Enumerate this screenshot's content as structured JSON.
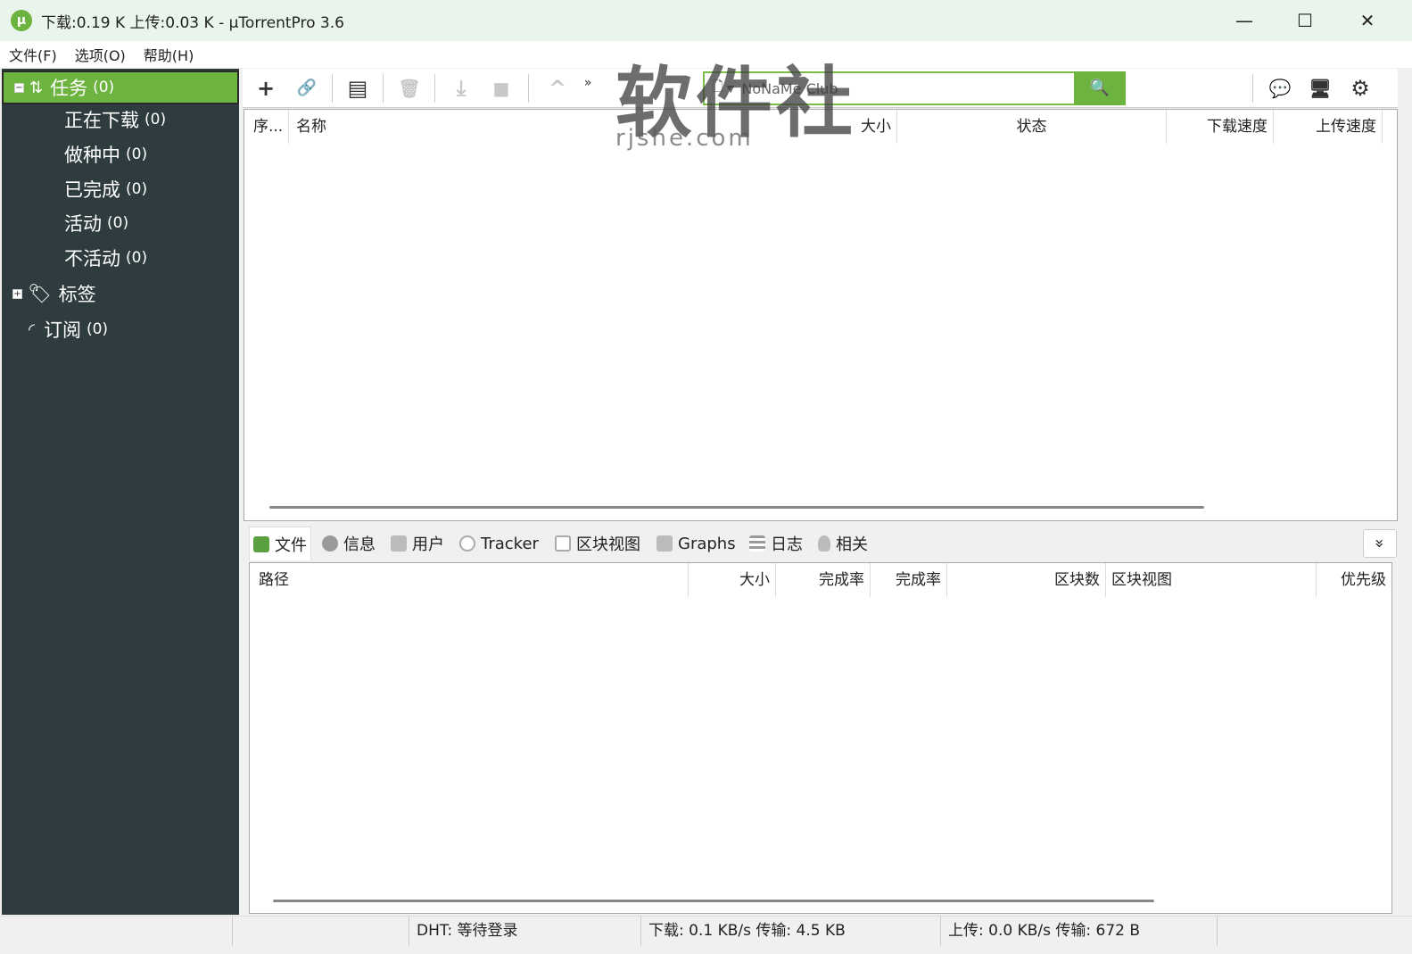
{
  "window": {
    "title": "下载:0.19 K 上传:0.03 K - µTorrentPro 3.6",
    "logo": "µ",
    "minimize": "—",
    "maximize": "☐",
    "close": "✕"
  },
  "menu": [
    "文件(F)",
    "选项(O)",
    "帮助(H)"
  ],
  "sidebar": {
    "tasks": {
      "label": "任务",
      "count": "(0)"
    },
    "items": [
      {
        "label": "正在下载",
        "count": "(0)"
      },
      {
        "label": "做种中",
        "count": "(0)"
      },
      {
        "label": "已完成",
        "count": "(0)"
      },
      {
        "label": "活动",
        "count": "(0)"
      },
      {
        "label": "不活动",
        "count": "(0)"
      }
    ],
    "labels": {
      "label": "标签"
    },
    "feeds": {
      "label": "订阅",
      "count": "(0)"
    }
  },
  "toolbar": {
    "add": "+",
    "add_url": "🔗",
    "create": "▤",
    "remove": "🗑",
    "download": "⤓",
    "stop": "■",
    "up": "^",
    "more": "»",
    "search_provider": "NoNaMe Club",
    "search_icon": "🔍",
    "chat": "💬",
    "remote": "🖥",
    "settings": "⚙"
  },
  "torrent_columns": [
    "序...",
    "名称",
    "大小",
    "状态",
    "下载速度",
    "上传速度"
  ],
  "tabs": [
    "文件",
    "信息",
    "用户",
    "Tracker",
    "区块视图",
    "Graphs",
    "日志",
    "相关"
  ],
  "detail_columns": [
    "路径",
    "大小",
    "完成率",
    "完成率",
    "区块数",
    "区块视图",
    "优先级"
  ],
  "expand_icon": "»",
  "status": {
    "dht": "DHT: 等待登录",
    "download": "下载: 0.1 KB/s 传输: 4.5 KB",
    "upload": "上传: 0.0 KB/s 传输: 672 B"
  },
  "watermark": {
    "text": "软件社",
    "url": "rjshe.com"
  },
  "colors": {
    "accent": "#6db33f",
    "sidebar": "#2f3c3f"
  }
}
